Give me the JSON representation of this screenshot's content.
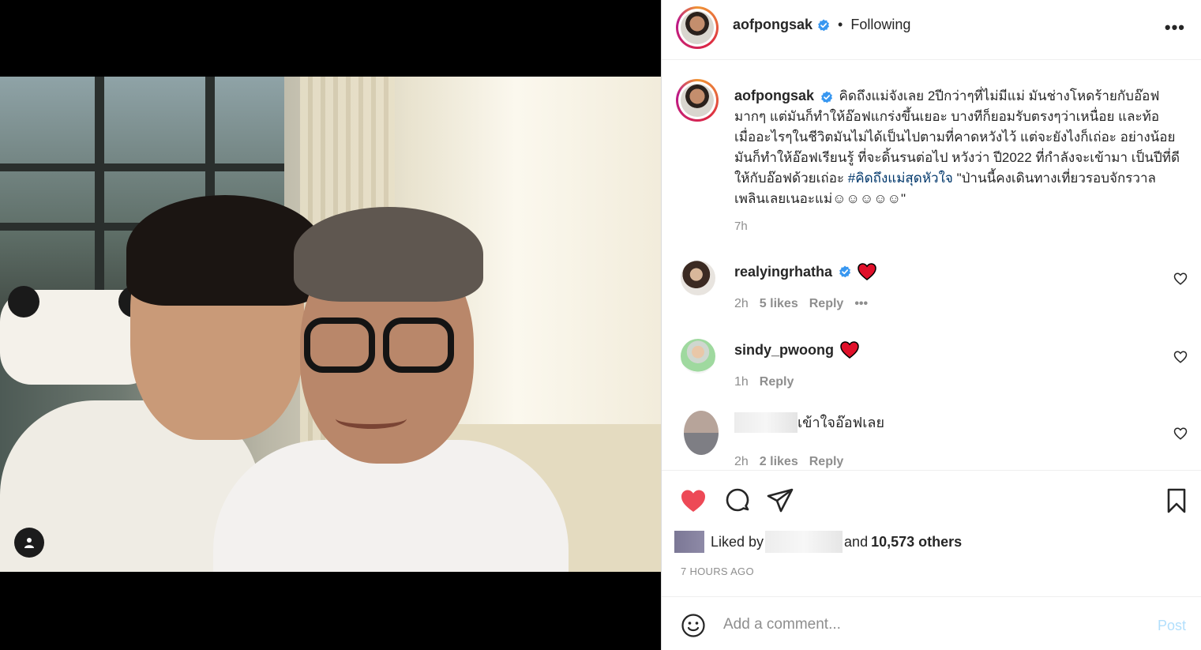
{
  "post": {
    "username": "aofpongsak",
    "verified": true,
    "follow_status": "Following",
    "more_label": "•••",
    "caption": {
      "text": "คิดถึงแม่จังเลย 2ปีกว่าๆที่ไม่มีแม่ มันช่างโหดร้ายกับอ๊อฟมากๆ แต่มันก็ทำให้อ๊อฟแกร่งขึ้นเยอะ บางทีก็ยอมรับตรงๆว่าเหนื่อย และท้อ เมื่ออะไรๆในชีวิตมันไม่ได้เป็นไปตามที่คาดหวังไว้ แต่จะยังไงก็เถ่อะ อย่างน้อยมันก็ทำให้อ๊อฟเรียนรู้ ที่จะดิ้นรนต่อไป หวังว่า ปี2022 ที่กำลังจะเข้ามา เป็นปีที่ดีให้กับอ๊อฟด้วยเถ่อะ",
      "hashtag": "#คิดถึงแม่สุดหัวใจ",
      "quote": "\"ป่านนี้คงเดินทางเที่ยวรอบจักรวาลเพลินเลยเนอะแม่☺☺☺☺☺\"",
      "time": "7h"
    }
  },
  "comments": [
    {
      "username": "realyingrhatha",
      "verified": true,
      "text": "",
      "reaction": "heart",
      "time": "2h",
      "likes": "5 likes",
      "reply": "Reply",
      "more": "•••"
    },
    {
      "username": "sindy_pwoong",
      "verified": false,
      "text": "",
      "reaction": "heart",
      "time": "1h",
      "likes": "",
      "reply": "Reply"
    },
    {
      "username": "",
      "verified": false,
      "text": "เข้าใจอ๊อฟเลย",
      "time": "2h",
      "likes": "2 likes",
      "reply": "Reply"
    }
  ],
  "likes": {
    "prefix": "Liked by",
    "middle": "and",
    "count_text": "10,573 others"
  },
  "timestamp": "7 HOURS AGO",
  "add_comment": {
    "placeholder": "Add a comment...",
    "post_label": "Post"
  },
  "colors": {
    "like_red": "#ed4956",
    "verified_blue": "#3897f0",
    "link": "#00376b",
    "muted": "#8e8e8e",
    "post_disabled": "#b2dffc"
  }
}
